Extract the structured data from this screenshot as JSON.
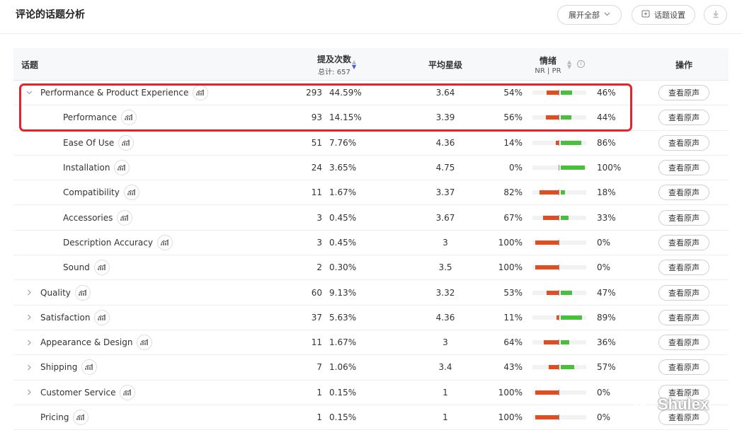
{
  "page": {
    "title": "评论的话题分析"
  },
  "header": {
    "expand_all": "展开全部",
    "topic_settings": "话题设置"
  },
  "table": {
    "headers": {
      "topic": "话题",
      "mentions": "提及次数",
      "total": "总计: 657",
      "rating": "平均星级",
      "sentiment": "情绪",
      "sentiment_sub": "NR | PR",
      "action": "操作"
    },
    "view_label": "查看原声",
    "rows": [
      {
        "level": 0,
        "expanded": true,
        "topic": "Performance & Product Experience",
        "count": "293",
        "pct": "44.59%",
        "rating": "3.64",
        "nr": "54%",
        "pr": "46%",
        "nr_value": 54,
        "pr_value": 46
      },
      {
        "level": 1,
        "topic": "Performance",
        "count": "93",
        "pct": "14.15%",
        "rating": "3.39",
        "nr": "56%",
        "pr": "44%",
        "nr_value": 56,
        "pr_value": 44
      },
      {
        "level": 1,
        "topic": "Ease Of Use",
        "count": "51",
        "pct": "7.76%",
        "rating": "4.36",
        "nr": "14%",
        "pr": "86%",
        "nr_value": 14,
        "pr_value": 86
      },
      {
        "level": 1,
        "topic": "Installation",
        "count": "24",
        "pct": "3.65%",
        "rating": "4.75",
        "nr": "0%",
        "pr": "100%",
        "nr_value": 0,
        "pr_value": 100
      },
      {
        "level": 1,
        "topic": "Compatibility",
        "count": "11",
        "pct": "1.67%",
        "rating": "3.37",
        "nr": "82%",
        "pr": "18%",
        "nr_value": 82,
        "pr_value": 18
      },
      {
        "level": 1,
        "topic": "Accessories",
        "count": "3",
        "pct": "0.45%",
        "rating": "3.67",
        "nr": "67%",
        "pr": "33%",
        "nr_value": 67,
        "pr_value": 33
      },
      {
        "level": 1,
        "topic": "Description Accuracy",
        "count": "3",
        "pct": "0.45%",
        "rating": "3",
        "nr": "100%",
        "pr": "0%",
        "nr_value": 100,
        "pr_value": 0
      },
      {
        "level": 1,
        "topic": "Sound",
        "count": "2",
        "pct": "0.30%",
        "rating": "3.5",
        "nr": "100%",
        "pr": "0%",
        "nr_value": 100,
        "pr_value": 0
      },
      {
        "level": 0,
        "expanded": false,
        "topic": "Quality",
        "count": "60",
        "pct": "9.13%",
        "rating": "3.32",
        "nr": "53%",
        "pr": "47%",
        "nr_value": 53,
        "pr_value": 47
      },
      {
        "level": 0,
        "expanded": false,
        "topic": "Satisfaction",
        "count": "37",
        "pct": "5.63%",
        "rating": "4.36",
        "nr": "11%",
        "pr": "89%",
        "nr_value": 11,
        "pr_value": 89
      },
      {
        "level": 0,
        "expanded": false,
        "topic": "Appearance & Design",
        "count": "11",
        "pct": "1.67%",
        "rating": "3",
        "nr": "64%",
        "pr": "36%",
        "nr_value": 64,
        "pr_value": 36
      },
      {
        "level": 0,
        "expanded": false,
        "topic": "Shipping",
        "count": "7",
        "pct": "1.06%",
        "rating": "3.4",
        "nr": "43%",
        "pr": "57%",
        "nr_value": 43,
        "pr_value": 57
      },
      {
        "level": 0,
        "expanded": false,
        "topic": "Customer Service",
        "count": "1",
        "pct": "0.15%",
        "rating": "1",
        "nr": "100%",
        "pr": "0%",
        "nr_value": 100,
        "pr_value": 0
      },
      {
        "level": 0,
        "expanded": null,
        "topic": "Pricing",
        "count": "1",
        "pct": "0.15%",
        "rating": "1",
        "nr": "100%",
        "pr": "0%",
        "nr_value": 100,
        "pr_value": 0
      }
    ]
  },
  "watermark": {
    "text": "Shulex"
  },
  "colors": {
    "negative": "#e44b1e",
    "positive": "#49bf3c",
    "highlight": "#e0262a",
    "sort_active": "#3d5adb"
  },
  "icons": {
    "trend": "trend-chart-icon",
    "expand": "chevron-down-icon",
    "collapse": "chevron-right-icon",
    "download": "download-icon",
    "settings": "add-square-icon",
    "info": "info-icon",
    "sort": "sort-icon"
  }
}
